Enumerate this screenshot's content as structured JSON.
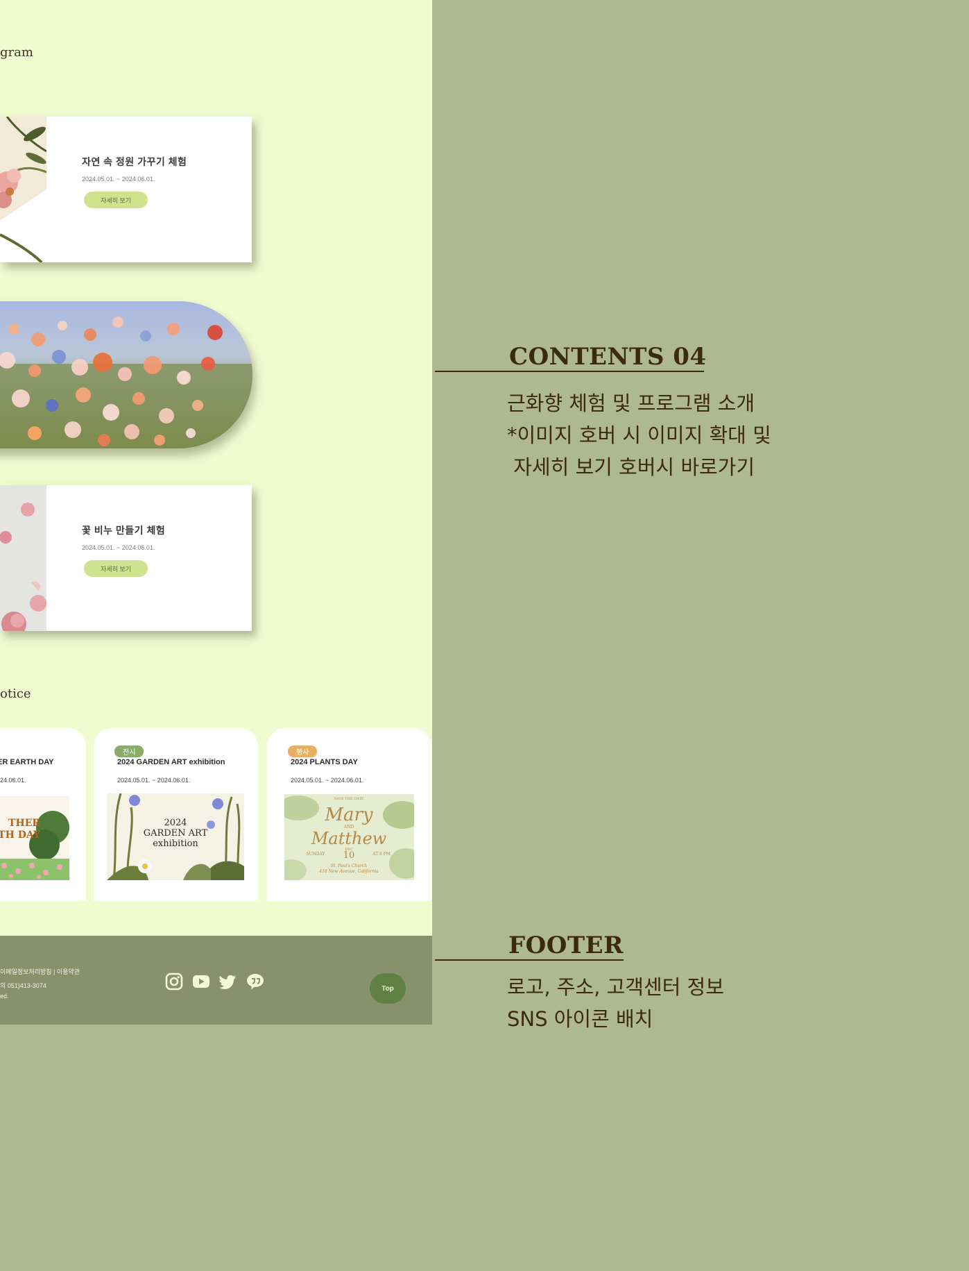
{
  "program": {
    "section_label": "gram",
    "cards": [
      {
        "title": "자연 속 정원 가꾸기 체험",
        "date": "2024.05.01. ~ 2024.06.01.",
        "button": "자세히 보기"
      },
      {
        "title": "꽃 비누 만들기 체험",
        "date": "2024.05.01. ~ 2024.06.01.",
        "button": "자세히 보기"
      }
    ]
  },
  "notice": {
    "section_label": "otice",
    "cards": [
      {
        "tag": "",
        "title": "ER EARTH DAY",
        "date": "24.06.01.",
        "image_text": [
          "THER",
          "TH DAY"
        ]
      },
      {
        "tag": "전시",
        "tag_color": "#8aac6d",
        "title": "2024 GARDEN ART exhibition",
        "date": "2024.05.01. ~ 2024.06.01.",
        "image_text": [
          "2024",
          "GARDEN ART",
          "exhibition"
        ]
      },
      {
        "tag": "행사",
        "tag_color": "#e8b065",
        "title": "2024 PLANTS DAY",
        "date": "2024.05.01. ~ 2024.06.01.",
        "image_text": [
          "SAVE THE DATE",
          "Mary",
          "AND",
          "Matthew",
          "SUNDAY",
          "DEC",
          "10",
          "AT 8 PM",
          "St. Paul's Church",
          "418 New Avenue, California"
        ]
      }
    ]
  },
  "footer": {
    "links": "이메일정보처리방침   |  이용약관",
    "phone": "의 051)413-3074",
    "copyright": "ed.",
    "sns_icons": [
      "instagram-icon",
      "youtube-icon",
      "twitter-icon",
      "kakaotalk-icon"
    ],
    "top_button": "Top"
  },
  "annotations": {
    "contents04": {
      "heading": "CONTENTS 04",
      "lines": [
        "근화향 체험 및 프로그램 소개",
        "*이미지 호버 시 이미지 확대 및",
        " 자세히 보기 호버시 바로가기"
      ]
    },
    "footer": {
      "heading": "FOOTER",
      "lines": [
        "로고, 주소, 고객센터 정보",
        "SNS 아이콘 배치"
      ]
    }
  },
  "colors": {
    "background": "#afb98f",
    "page": "#f1fbd0",
    "footer": "#88906c",
    "top_button": "#5f8143",
    "annotation_text": "#3b2a0c",
    "detail_button": "#cfe28e"
  }
}
